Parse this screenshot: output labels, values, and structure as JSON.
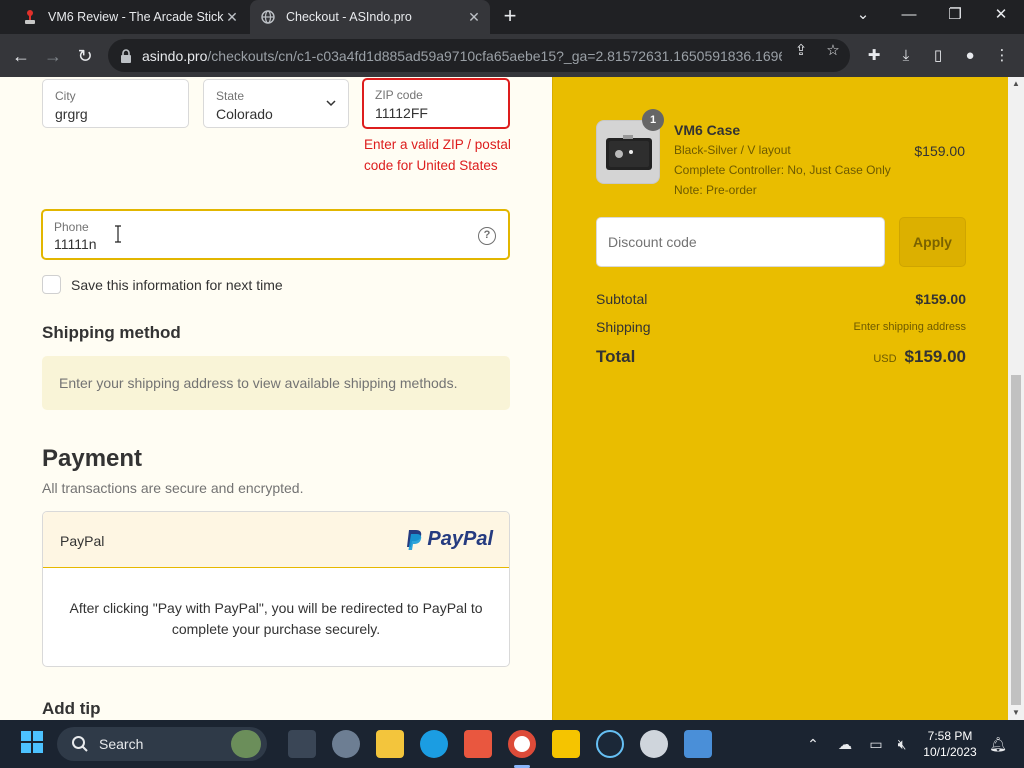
{
  "browser": {
    "tabs": [
      {
        "title": "VM6 Review - The Arcade Stick",
        "active": false
      },
      {
        "title": "Checkout - ASIndo.pro",
        "active": true
      }
    ],
    "url_host": "asindo.pro",
    "url_path": "/checkouts/cn/c1-c03a4fd1d885ad59a9710cfa65aebe15?_ga=2.81572631.1650591836.1696..."
  },
  "form": {
    "city": {
      "label": "City",
      "value": "grgrg"
    },
    "state": {
      "label": "State",
      "value": "Colorado"
    },
    "zip": {
      "label": "ZIP code",
      "value": "11112FF",
      "error": "Enter a valid ZIP / postal code for United States"
    },
    "phone": {
      "label": "Phone",
      "value": "11111n"
    },
    "save_info": "Save this information for next time"
  },
  "shipping": {
    "heading": "Shipping method",
    "message": "Enter your shipping address to view available shipping methods."
  },
  "payment": {
    "heading": "Payment",
    "subtitle": "All transactions are secure and encrypted.",
    "method_label": "PayPal",
    "logo_text": "PayPal",
    "info": "After clicking \"Pay with PayPal\", you will be redirected to PayPal to complete your purchase securely."
  },
  "tip_heading": "Add tip",
  "order": {
    "quantity": "1",
    "product_name": "VM6 Case",
    "variant_lines": [
      "Black-Silver / V layout",
      "Complete Controller: No, Just Case Only",
      "Note: Pre-order"
    ],
    "price": "$159.00",
    "discount_placeholder": "Discount code",
    "apply_label": "Apply",
    "subtotal_label": "Subtotal",
    "subtotal_value": "$159.00",
    "shipping_label": "Shipping",
    "shipping_value": "Enter shipping address",
    "total_label": "Total",
    "currency": "USD",
    "total_value": "$159.00"
  },
  "taskbar": {
    "search_label": "Search",
    "time": "7:58 PM",
    "date": "10/1/2023"
  },
  "colors": {
    "summary_bg": "#e9bd00",
    "page_bg": "#fffdf3",
    "error": "#dd1d1d",
    "paypal_dark": "#253b80",
    "paypal_light": "#179bd7"
  }
}
